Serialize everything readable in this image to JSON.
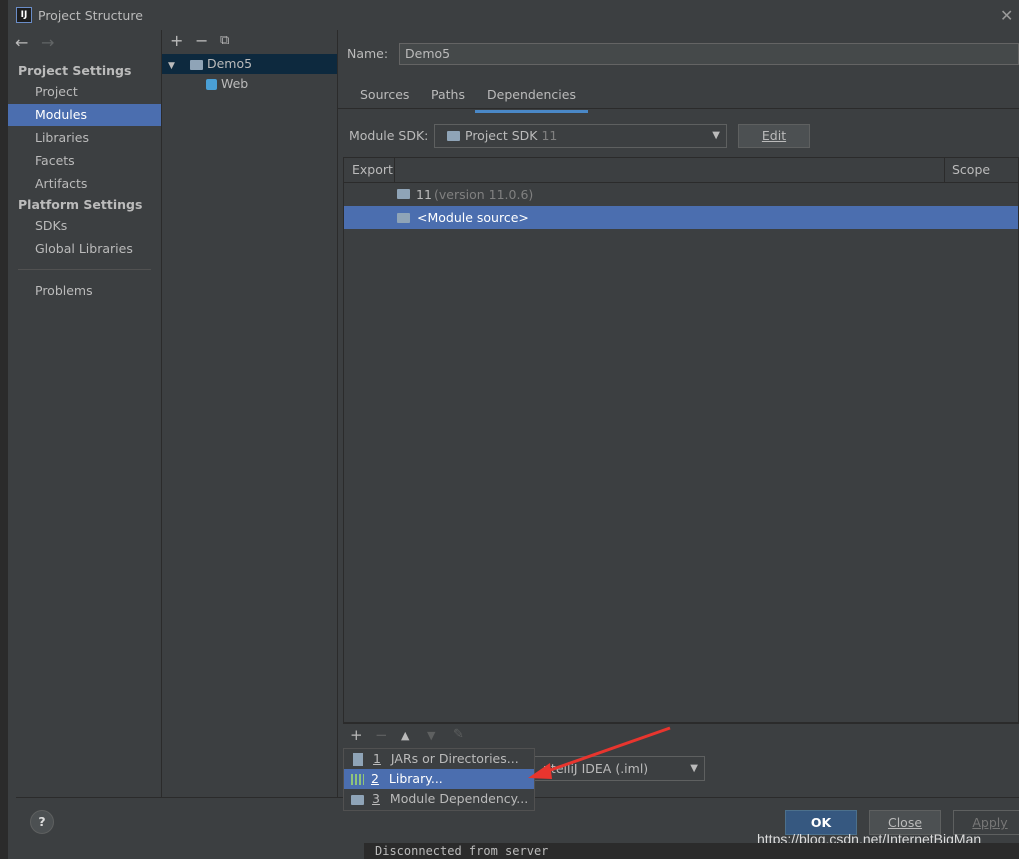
{
  "window": {
    "title": "Project Structure",
    "logo": "IJ",
    "close_icon": "close-icon"
  },
  "sidebar": {
    "project_settings_header": "Project Settings",
    "project_items": [
      "Project",
      "Modules",
      "Libraries",
      "Facets",
      "Artifacts"
    ],
    "platform_settings_header": "Platform Settings",
    "platform_items": [
      "SDKs",
      "Global Libraries"
    ],
    "problems": "Problems",
    "selected": "Modules"
  },
  "module_tree": {
    "root": "Demo5",
    "child": "Web"
  },
  "module": {
    "name_label": "Name:",
    "name_value": "Demo5",
    "tabs": [
      "Sources",
      "Paths",
      "Dependencies"
    ],
    "active_tab": "Dependencies",
    "sdk_label": "Module SDK:",
    "sdk_value": "Project SDK",
    "sdk_version": "11",
    "edit_label": "Edit"
  },
  "dependencies": {
    "col_export": "Export",
    "col_scope": "Scope",
    "rows": [
      {
        "name": "11",
        "detail": "(version 11.0.6)"
      },
      {
        "name": "<Module source>",
        "detail": ""
      }
    ],
    "format_value": "ntelliJ IDEA (.iml)"
  },
  "add_popup": {
    "items": [
      {
        "num": "1",
        "label": "JARs or Directories..."
      },
      {
        "num": "2",
        "label": "Library..."
      },
      {
        "num": "3",
        "label": "Module Dependency..."
      }
    ]
  },
  "footer": {
    "help": "?",
    "ok": "OK",
    "close": "Close",
    "apply": "Apply"
  },
  "watermark": "https://blog.csdn.net/InternetBigMan",
  "console_text": "Disconnected from server",
  "colors": {
    "selection": "#4b6eaf",
    "panel": "#3c3f41",
    "arrow": "#e8352e"
  }
}
